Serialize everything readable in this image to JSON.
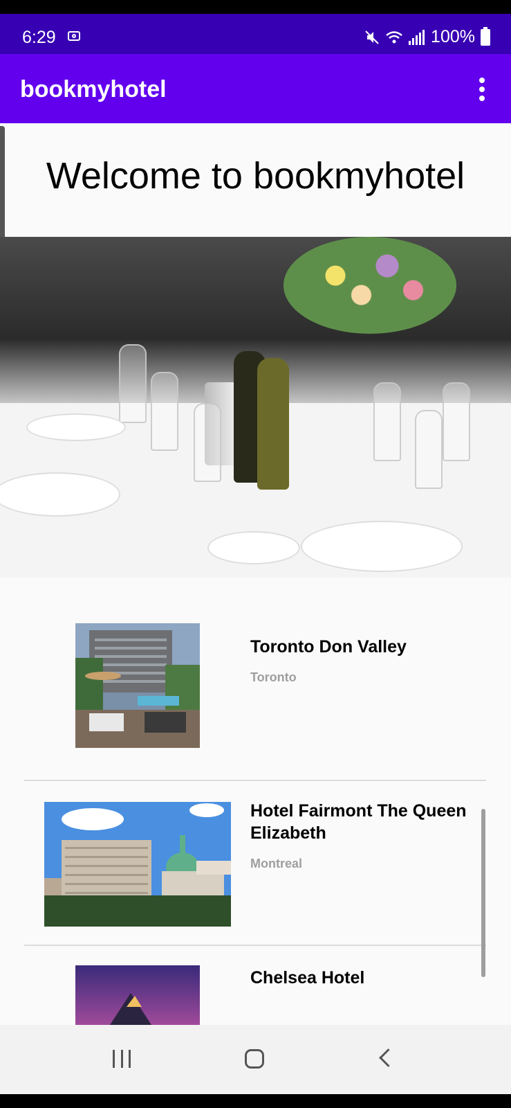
{
  "status_bar": {
    "time": "6:29",
    "battery": "100%",
    "icons": [
      "screenshot-icon",
      "mute-icon",
      "wifi-icon",
      "signal-icon",
      "battery-icon"
    ]
  },
  "app_bar": {
    "title": "bookmyhotel",
    "menu_icon": "overflow-menu-icon",
    "background": "#6200ee"
  },
  "main": {
    "welcome": "Welcome to bookmyhotel",
    "hotels": [
      {
        "name": "Toronto Don Valley",
        "city": "Toronto"
      },
      {
        "name": "Hotel Fairmont The Queen Elizabeth",
        "city": "Montreal"
      },
      {
        "name": "Chelsea Hotel",
        "city": ""
      }
    ]
  },
  "nav_bar": {
    "icons": [
      "recent-apps-icon",
      "home-icon",
      "back-icon"
    ]
  },
  "colors": {
    "status_bar": "#3700b3",
    "app_bar": "#6200ee",
    "city_text": "#9e9e9e"
  }
}
